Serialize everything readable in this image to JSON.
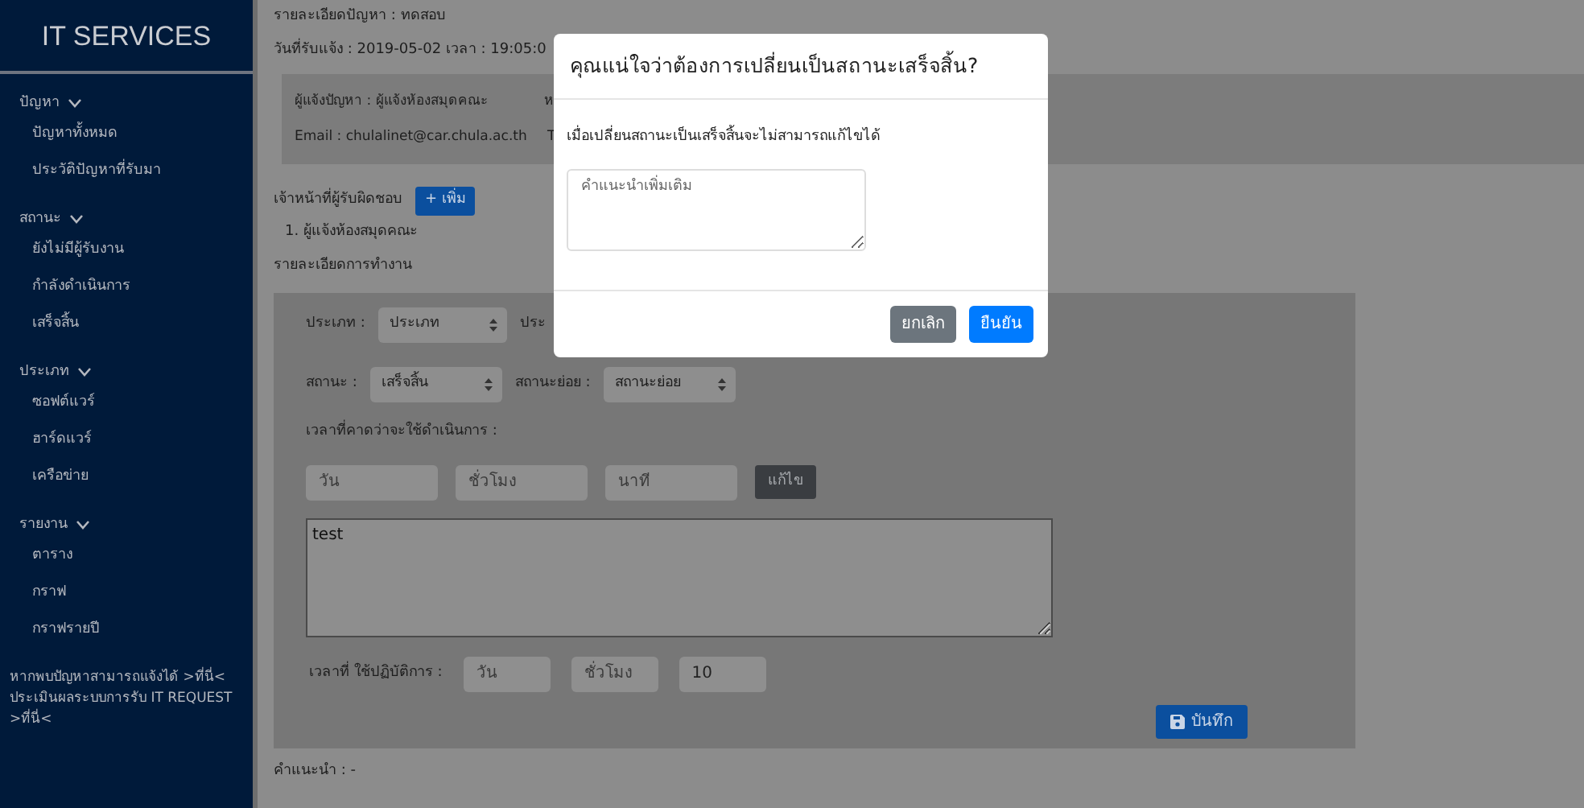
{
  "sidebar": {
    "title": "IT SERVICES",
    "groups": [
      {
        "label": "ปัญหา",
        "expanded": true,
        "items": [
          "ปัญหาทั้งหมด",
          "ประวัติปัญหาที่รับมา"
        ]
      },
      {
        "label": "สถานะ",
        "expanded": true,
        "items": [
          "ยังไม่มีผู้รับงาน",
          "กำลังดำเนินการ",
          "เสร็จสิ้น"
        ]
      },
      {
        "label": "ประเภท",
        "expanded": true,
        "items": [
          "ซอฟต์แวร์",
          "ฮาร์ดแวร์",
          "เครือข่าย"
        ]
      },
      {
        "label": "รายงาน",
        "expanded": true,
        "items": [
          "ตาราง",
          "กราฟ",
          "กราฟรายปี"
        ]
      }
    ],
    "footer_links": [
      "หากพบปัญหาสามารถแจ้งได้ >ที่นี่<",
      "ประเมินผลระบบการรับ IT REQUEST >ที่นี่<"
    ]
  },
  "detail": {
    "description": "รายละเอียดปัญหา : ทดสอบ",
    "received": "วันที่รับแจ้ง : 2019-05-02 เวลา : 19:05:0",
    "reporter": {
      "name": "ผู้แจ้งปัญหา : ผู้แจ้งห้องสมุดคณะ",
      "name_cut": "ห",
      "email": "Email : chulalinet@car.chula.ac.th",
      "email_cut": "T"
    },
    "staff_label": "เจ้าหน้าที่ผู้รับผิดชอบ",
    "add_button": "+ เพิ่ม",
    "staff": [
      "1. ผู้แจ้งห้องสมุดคณะ"
    ],
    "work_label": "รายละเอียดการทำงาน"
  },
  "work": {
    "type_label": "ประเภท :",
    "type_value": "ประเภท",
    "type_cut": "ประ",
    "status_label": "สถานะ :",
    "status_value": "เสร็จสิ้น",
    "substatus_label": "สถานะย่อย :",
    "substatus_value": "สถานะย่อย",
    "estimate_label": "เวลาที่คาดว่าจะใช้ดำเนินการ :",
    "estimate_fields": [
      {
        "placeholder": "วัน"
      },
      {
        "placeholder": "ชั่วโมง"
      },
      {
        "placeholder": "นาที"
      }
    ],
    "edit_button": "แก้ไข",
    "notes": "test",
    "actual_label": "เวลาที่ ใช้ปฏิบัติการ :",
    "actual_fields": [
      {
        "placeholder": "วัน"
      },
      {
        "placeholder": "ชั่วโมง"
      },
      {
        "value": "10"
      }
    ],
    "save_button": "บันทึก"
  },
  "advice": "คำแนะนำ : -",
  "modal": {
    "title": "คุณแน่ใจว่าต้องการเปลี่ยนเป็นสถานะเสร็จสิ้น?",
    "message": "เมื่อเปลี่ยนสถานะเป็นเสร็จสิ้นจะไม่สามารถแก้ไขได้",
    "comment_placeholder": "คำแนะนำเพิ่มเติม",
    "cancel": "ยกเลิก",
    "confirm": "ยืนยัน"
  }
}
